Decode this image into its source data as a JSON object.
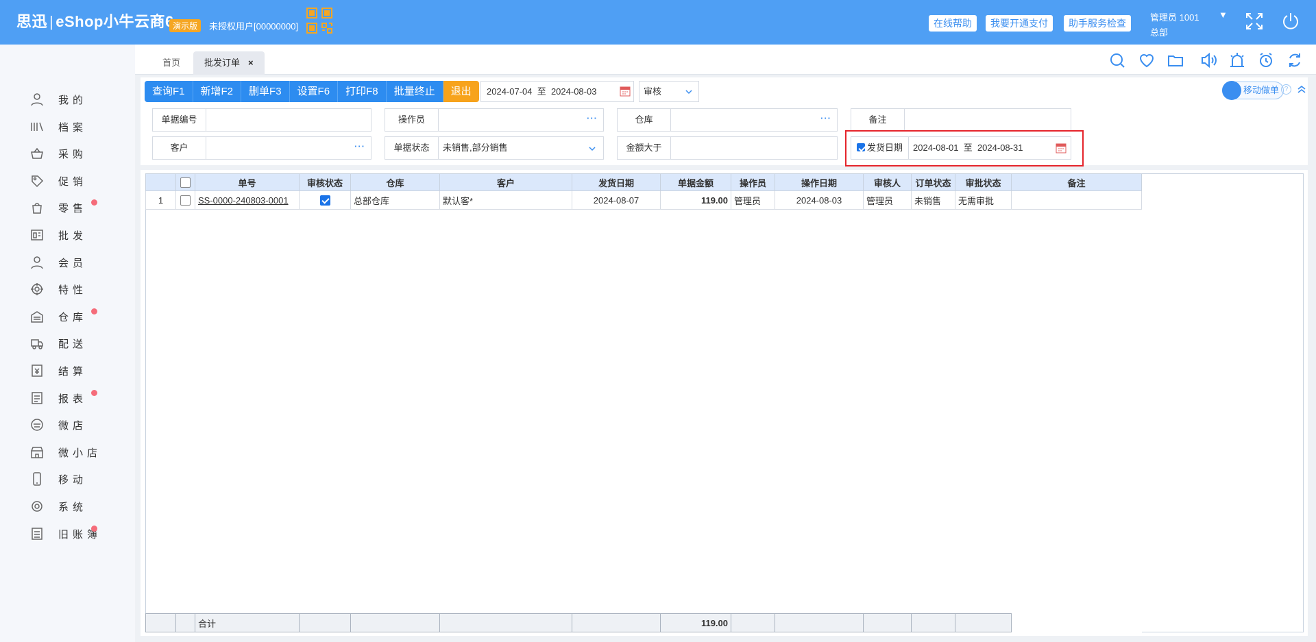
{
  "header": {
    "logo_cn": "思迅",
    "logo_en": "eShop小牛云商6",
    "demo_badge": "演示版",
    "unauth_user": "未授权用户[00000000]",
    "help_buttons": [
      "在线帮助",
      "我要开通支付",
      "助手服务检查"
    ],
    "user_name": "管理员 1001",
    "user_caret": "▼",
    "user_dept": "总部",
    "icons": [
      "qr-code-icon",
      "fullscreen-icon",
      "power-icon"
    ]
  },
  "sidebar": {
    "items": [
      {
        "label": "我的",
        "icon": "user-icon",
        "dot": false
      },
      {
        "label": "档案",
        "icon": "archive-icon",
        "dot": false
      },
      {
        "label": "采购",
        "icon": "basket-icon",
        "dot": false
      },
      {
        "label": "促销",
        "icon": "tag-icon",
        "dot": false
      },
      {
        "label": "零售",
        "icon": "bag-icon",
        "dot": true
      },
      {
        "label": "批发",
        "icon": "wholesale-icon",
        "dot": false
      },
      {
        "label": "会员",
        "icon": "member-icon",
        "dot": false
      },
      {
        "label": "特性",
        "icon": "target-icon",
        "dot": false
      },
      {
        "label": "仓库",
        "icon": "warehouse-icon",
        "dot": true
      },
      {
        "label": "配送",
        "icon": "truck-icon",
        "dot": false
      },
      {
        "label": "结算",
        "icon": "settle-icon",
        "dot": false
      },
      {
        "label": "报表",
        "icon": "report-icon",
        "dot": true
      },
      {
        "label": "微店",
        "icon": "wechat-shop-icon",
        "dot": false
      },
      {
        "label": "微小店",
        "icon": "mini-shop-icon",
        "dot": false
      },
      {
        "label": "移动",
        "icon": "mobile-icon",
        "dot": false
      },
      {
        "label": "系统",
        "icon": "gear-icon",
        "dot": false
      },
      {
        "label": "旧账簿",
        "icon": "ledger-icon",
        "dot": true
      }
    ]
  },
  "tabs": {
    "home": "首页",
    "active": "批发订单",
    "close": "×",
    "tools": [
      "search-icon",
      "heart-icon",
      "folder-icon",
      "speaker-icon",
      "alarm-light-icon",
      "clock-icon",
      "refresh-icon"
    ]
  },
  "toolbar": {
    "buttons": [
      "查询F1",
      "新增F2",
      "删单F3",
      "设置F6",
      "打印F8",
      "批量终止"
    ],
    "exit": "退出",
    "date_range": "2024-07-04  至  2024-08-03",
    "audit_select": "审核",
    "mobile_btn": "移动做单",
    "help_q": "?"
  },
  "filters": {
    "doc_no_label": "单据编号",
    "doc_no_value": "",
    "operator_label": "操作员",
    "operator_value": "",
    "warehouse_label": "仓库",
    "warehouse_value": "",
    "remark_label": "备注",
    "remark_value": "",
    "customer_label": "客户",
    "customer_value": "",
    "status_label": "单据状态",
    "status_value": "未销售,部分销售",
    "amount_label": "金额大于",
    "amount_value": "",
    "ship_date_label": "发货日期",
    "ship_date_value": "2024-08-01  至  2024-08-31",
    "dots": "···"
  },
  "grid": {
    "columns": [
      "单号",
      "审核状态",
      "仓库",
      "客户",
      "发货日期",
      "单据金额",
      "操作员",
      "操作日期",
      "审核人",
      "订单状态",
      "审批状态",
      "备注"
    ],
    "rows": [
      {
        "idx": "1",
        "doc_no": "SS-0000-240803-0001",
        "audited": true,
        "warehouse": "总部仓库",
        "customer": "默认客*",
        "ship_date": "2024-08-07",
        "amount": "119.00",
        "operator": "管理员",
        "op_date": "2024-08-03",
        "auditor": "管理员",
        "order_status": "未销售",
        "approval_status": "无需审批",
        "remark": ""
      }
    ],
    "footer": {
      "label": "合计",
      "amount": "119.00"
    }
  }
}
